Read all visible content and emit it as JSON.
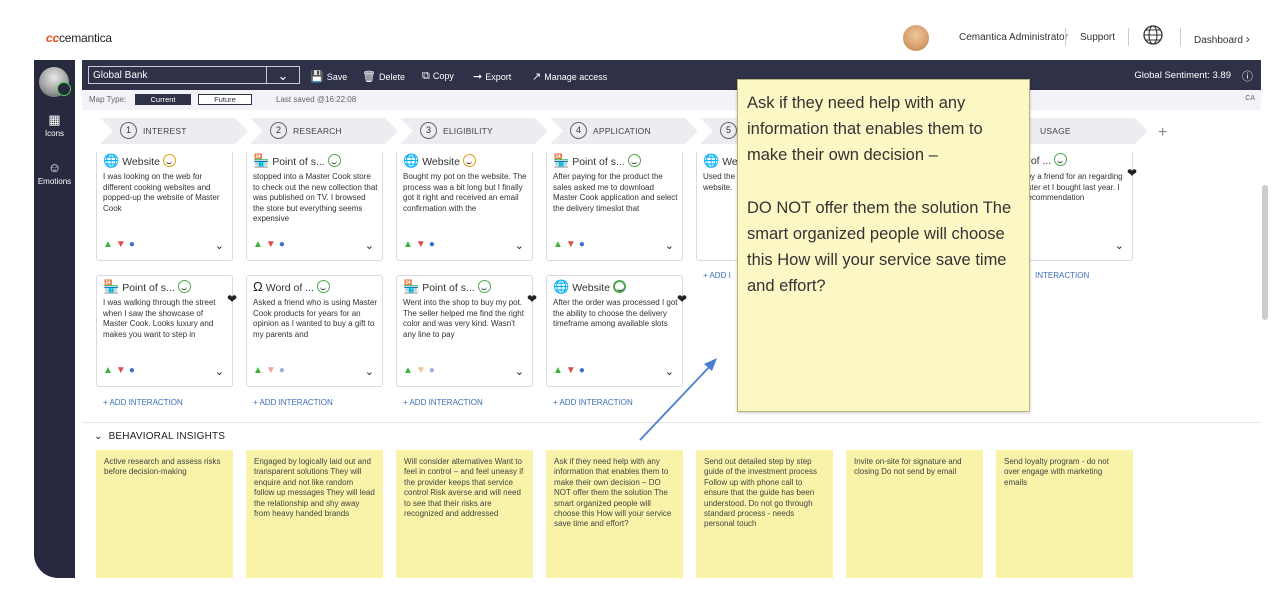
{
  "header": {
    "logo_prefix": "cc",
    "logo_text": "cemantica",
    "user_name": "Cemantica Administrator",
    "support": "Support",
    "dashboard": "Dashboard"
  },
  "sidebar": {
    "items": [
      {
        "label": "Icons",
        "icon": "icons-icon"
      },
      {
        "label": "Emotions",
        "icon": "smile-icon"
      }
    ]
  },
  "toolbar": {
    "map_name": "Global Bank",
    "save": "Save",
    "delete": "Delete",
    "copy": "Copy",
    "export": "Export",
    "manage_access": "Manage access",
    "global_sentiment": "Global Sentiment: 3.89"
  },
  "maptype": {
    "label": "Map Type:",
    "current": "Current",
    "future": "Future",
    "last_saved": "Last saved @16:22:08",
    "ca": "CA"
  },
  "stages": [
    {
      "num": "1",
      "label": "INTEREST"
    },
    {
      "num": "2",
      "label": "RESEARCH"
    },
    {
      "num": "3",
      "label": "ELIGIBILITY"
    },
    {
      "num": "4",
      "label": "APPLICATION"
    },
    {
      "num": "5",
      "label": ""
    },
    {
      "num": "",
      "label": "USAGE"
    }
  ],
  "cards": [
    {
      "title": "Website",
      "icon": "globe-icon",
      "emotion": "neutral-orange",
      "text": "I was looking on the web for different cooking websites and popped-up the website of Master Cook",
      "heart": false
    },
    {
      "title": "Point of s...",
      "icon": "store-icon",
      "emotion": "happy-green",
      "text": "stopped into a Master Cook store to check out the new collection that was published on TV. I browsed the store but everything seems expensive",
      "heart": false
    },
    {
      "title": "Website",
      "icon": "globe-icon",
      "emotion": "neutral-orange",
      "text": "Bought my pot on the website. The process was a bit long but I finally got it right and received an email confirmation with the",
      "heart": false
    },
    {
      "title": "Point of s...",
      "icon": "store-icon",
      "emotion": "happy-green",
      "text": "After paying for the product the sales asked me to download Master Cook application and select the delivery timeslot that",
      "heart": false
    },
    {
      "title": "We",
      "icon": "globe-icon",
      "emotion": "",
      "text": "Used the in the ov downloa website.",
      "heart": false
    },
    {
      "title": "Word of ...",
      "icon": "word-of-mouth-icon",
      "emotion": "happy-green",
      "text": "asked by a friend for an regarding the Master et I bought last year. I warm recommendation",
      "heart": true
    },
    {
      "title": "Point of s...",
      "icon": "store-icon",
      "emotion": "happy-green",
      "text": "I was walking through the street when I saw the showcase of Master Cook. Looks luxury and makes you want to step in",
      "heart": true
    },
    {
      "title": "Word of ...",
      "icon": "word-of-mouth-icon",
      "emotion": "happy-green",
      "text": "Asked a friend who is using Master Cook products for years for an opinion as I wanted to buy a gift to my parents and",
      "heart": false
    },
    {
      "title": "Point of s...",
      "icon": "store-icon",
      "emotion": "happy-green",
      "text": "Went into the shop to buy my pot. The seller helped me find the right color and was very kind. Wasn't any line to pay",
      "heart": true
    },
    {
      "title": "Website",
      "icon": "globe-icon",
      "emotion": "very-happy-green",
      "text": "After the order was processed I got the ability to choose the delivery timeframe among available slots",
      "heart": true
    }
  ],
  "add_interaction": "+ ADD INTERACTION",
  "add_interaction_short": "+ ADD I",
  "add_interaction_right": "INTERACTION",
  "callout_text": "Ask if they need help with any information that enables them to make their own decision –\n\nDO NOT offer them the solution The smart organized people will choose this How will your service save time and effort?",
  "behavioral": {
    "title": "BEHAVIORAL INSIGHTS",
    "notes": [
      "Active research and assess risks before decision-making",
      "Engaged by logically laid out and transparent solutions They will enquire and not like random follow up messages  They will lead the relationship and shy away from heavy handed brands",
      "Will consider alternatives Want to feel in control – and feel uneasy if the provider keeps that service control Risk averse and will need to see that their risks are recognized and addressed",
      "Ask if they need help with any information that enables them to make their own decision –  DO NOT offer them the solution The smart organized people will choose this How will your service save time and effort?",
      "Send out detailed step by step guide of the investment process  Follow up with phone call to ensure that the guide has been understood.  Do not go through standard process - needs personal touch",
      "Invite on-site for signature and closing  Do not send by email",
      "Send loyalty program - do not over engage with marketing emails"
    ]
  },
  "colors": {
    "brand_orange": "#e2521f",
    "toolbar_bg": "#2e3148",
    "sidebar_bg": "#272a3e",
    "note_yellow": "#f8f3a8",
    "callout_yellow": "#fbf8c5",
    "link_blue": "#3a6fb5",
    "arrow_blue": "#4a7fd0"
  }
}
